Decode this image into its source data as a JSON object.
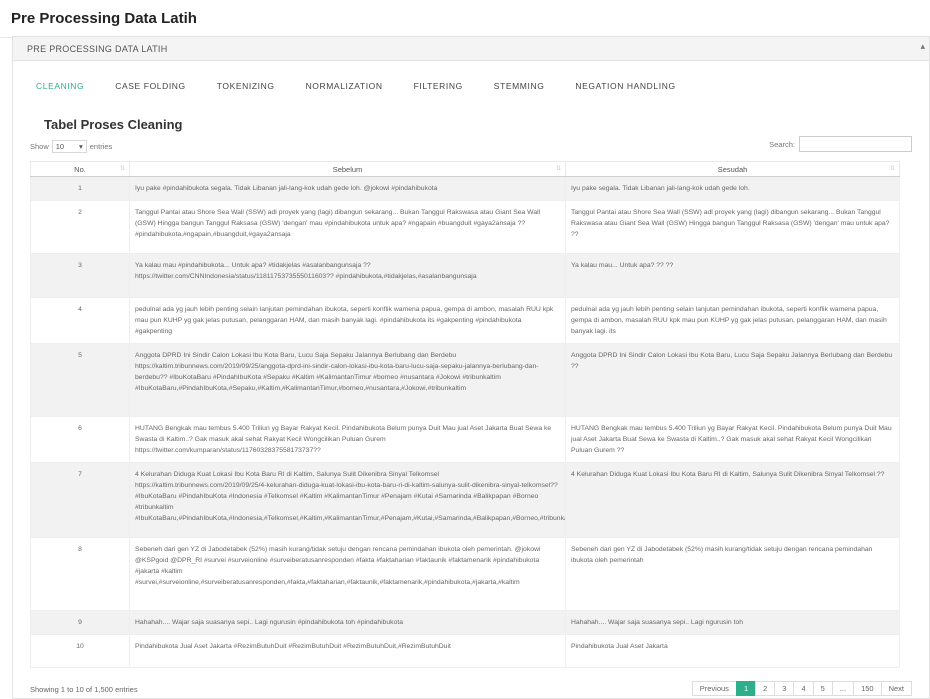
{
  "page_title": "Pre Processing Data Latih",
  "panel": {
    "title": "PRE PROCESSING DATA LATIH",
    "collapse_glyph": "▴"
  },
  "tabs": [
    {
      "label": "CLEANING",
      "active": true
    },
    {
      "label": "CASE FOLDING"
    },
    {
      "label": "TOKENIZING"
    },
    {
      "label": "NORMALIZATION"
    },
    {
      "label": "FILTERING"
    },
    {
      "label": "STEMMING"
    },
    {
      "label": "NEGATION HANDLING"
    }
  ],
  "section_title": "Tabel Proses Cleaning",
  "length_control": {
    "show": "Show",
    "value": "10",
    "arrow": "▾",
    "entries": "entries"
  },
  "search": {
    "label": "Search:",
    "value": ""
  },
  "table": {
    "columns": [
      "No.",
      "Sebelum",
      "Sesudah"
    ],
    "sort_glyph": "⇅",
    "rows": [
      {
        "no": "1",
        "sebelum": "Iyu pake #pindahibukota segala. Tidak Libanan jali-lang-kok udah gede loh. @jokowi #pindahibukota",
        "sesudah": "Iyu pake segala. Tidak Libanan jali-lang-kok udah gede loh."
      },
      {
        "no": "2",
        "sebelum": "Tanggul Pantai atau Shore Sea Wall (SSW) adl proyek yang (lagi) dibangun sekarang... Bukan Tanggul Rakswasa atau Giant Sea Wall (GSW) Hingga bangun Tanggul Raksasa (GSW) 'dengan' mau #pindahibukota untuk apa? #ngapain #buangduit #gaya2ansaja ?? #pindahibukota,#ngapain,#buangduit,#gaya2ansaja",
        "sesudah": "Tanggul Pantai atau Shore Sea Wall (SSW) adl proyek yang (lagi) dibangun sekarang... Bukan Tanggul Rakswasa atau Giant Sea Wall (GSW) Hingga bangun Tanggul Raksasa (GSW) 'dengan' mau untuk apa? ??"
      },
      {
        "no": "3",
        "sebelum": "Ya kalau mau #pindahibukota... Untuk apa? #tidakjelas #asalanbangunsaja ?? https://twitter.com/CNNIndonesia/status/1181175373555011603?? #pindahibukota,#tidakjelas,#asalanbangunsaja",
        "sesudah": "Ya kalau mau... Untuk apa? ?? ??"
      },
      {
        "no": "4",
        "sebelum": "pedulnal ada yg jauh lebih penting selain lanjutan pemindahan ibukota, seperti konflik wamena papua, gempa di ambon, masalah RUU kpk mau pun KUHP yg gak jelas putusan, pelanggaran HAM, dan masih banyak lagi. #pindahibukota its #gakpenting #pindahibukota #gakpenting",
        "sesudah": "pedulnal ada yg jauh lebih penting selain lanjutan pemindahan ibukota, seperti konflik wamena papua, gempa di ambon, masalah RUU kpk mau pun KUHP yg gak jelas putusan, pelanggaran HAM, dan masih banyak lagi. its"
      },
      {
        "no": "5",
        "sebelum": "Anggota DPRD Ini Sindir Calon Lokasi Ibu Kota Baru, Lucu Saja Sepaku Jalannya Berlubang dan Berdebu https://kaltim.tribunnews.com/2019/09/25/anggota-dprd-ini-sindir-calon-lokasi-ibu-kota-baru-lucu-saja-sepaku-jalannya-berlubang-dan-berdebu?? #IbuKotaBaru #PindahIbuKota #Sepaku #Kaltim #KalimantanTimur #borneo #nusantara #Jokowi #tribunkaltim #IbuKotaBaru,#PindahIbuKota,#Sepaku,#Kaltim,#KalimantanTimur,#borneo,#nusantara,#Jokowi,#tribunkaltim",
        "sesudah": "Anggota DPRD Ini Sindir Calon Lokasi Ibu Kota Baru, Lucu Saja Sepaku Jalannya Berlubang dan Berdebu ??"
      },
      {
        "no": "6",
        "sebelum": "HUTANG Bengkak mau tembus 5.400 Triliun yg Bayar Rakyat Kecil. Pindahibukota Belum punya Duit Mau jual Aset Jakarta Buat Sewa ke Swasta di Kaltim..? Gak masuk akal sehat Rakyat Kecil Wongcilikan Puluan Gurem https://twitter.com/kumparan/status/1176032837558173737??",
        "sesudah": "HUTANG Bengkak mau tembus 5.400 Triliun yg Bayar Rakyat Kecil. Pindahibukota Belum punya Duit Mau jual Aset Jakarta Buat Sewa ke Swasta di Kaltim..? Gak masuk akal sehat Rakyat Kecil Wongcilikan Puluan Gurem ??"
      },
      {
        "no": "7",
        "sebelum": "4 Kelurahan Diduga Kuat Lokasi Ibu Kota Baru RI di Kaltim, Salunya Sulit Dikenibra Sinyal Telkomsel https://kaltim.tribunnews.com/2019/09/25/4-kelurahan-diduga-kuat-lokasi-ibu-kota-baru-ri-di-kaltim-salunya-sulit-dikenibra-sinyal-telkomsel?? #IbuKotaBaru #PindahIbuKota #Indonesia #Telkomsel #Kaltim #KalimantanTimur #Penajam #Kutai #Samarinda #Balikpapan #Borneo #tribunkaltim #IbuKotaBaru,#PindahIbuKota,#Indonesia,#Telkomsel,#Kaltim,#KalimantanTimur,#Penajam,#Kutai,#Samarinda,#Balikpapan,#Borneo,#tribunkaltim",
        "sesudah": "4 Kelurahan Diduga Kuat Lokasi Ibu Kota Baru RI di Kaltim, Salunya Sulit Dikenibra Sinyal Telkomsel ??"
      },
      {
        "no": "8",
        "sebelum": "Sebeneh dari gen YZ di Jabodetabek (52%) masih kurang/tidak setuju dengan rencana pemindahan ibukota oleh pemerintah. @jokowi @KSPgoid @DPR_RI #survei #surveionline #surveiberatusanresponden #fakta #faktaharian #faktaunik #faktamenarik #pindahibukota #jakarta #kaltim #survei,#surveionline,#surveiberatusanresponden,#fakta,#faktaharian,#faktaunik,#faktamenarik,#pindahibukota,#jakarta,#kaltim",
        "sesudah": "Sebeneh dari gen YZ di Jabodetabek (52%) masih kurang/tidak setuju dengan rencana pemindahan ibukota oleh pemerintah"
      },
      {
        "no": "9",
        "sebelum": "Hahahah.... Wajar saja suasanya sepi.. Lagi ngurusin #pindahibukota toh #pindahibukota",
        "sesudah": "Hahahah.... Wajar saja suasanya sepi.. Lagi ngurusin toh"
      },
      {
        "no": "10",
        "sebelum": "Pindahibukota Jual Aset Jakarta #RezimButuhDuit #RezimButuhDuit #RezimButuhDuit,#RezimButuhDuit",
        "sesudah": "Pindahibukota Jual Aset Jakarta"
      }
    ]
  },
  "footer": {
    "info": "Showing 1 to 10 of 1,500 entries",
    "pagination": [
      "Previous",
      "1",
      "2",
      "3",
      "4",
      "5",
      "...",
      "150",
      "Next"
    ],
    "active_page": "1"
  },
  "colors": {
    "accent": "#2eaf8c"
  }
}
